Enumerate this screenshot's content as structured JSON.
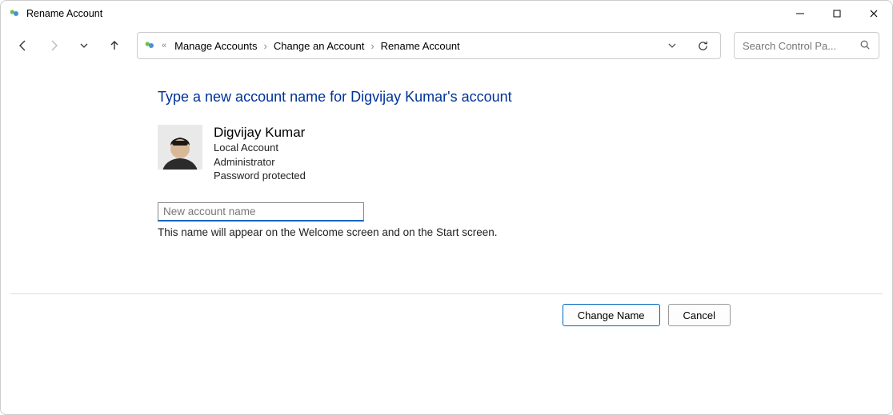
{
  "window": {
    "title": "Rename Account"
  },
  "breadcrumb": {
    "items": [
      "Manage Accounts",
      "Change an Account",
      "Rename Account"
    ]
  },
  "search": {
    "placeholder": "Search Control Pa..."
  },
  "main": {
    "heading": "Type a new account name for Digvijay Kumar's account",
    "account": {
      "name": "Digvijay Kumar",
      "type": "Local Account",
      "role": "Administrator",
      "protection": "Password protected"
    },
    "input_placeholder": "New account name",
    "hint": "This name will appear on the Welcome screen and on the Start screen."
  },
  "buttons": {
    "primary": "Change Name",
    "secondary": "Cancel"
  }
}
